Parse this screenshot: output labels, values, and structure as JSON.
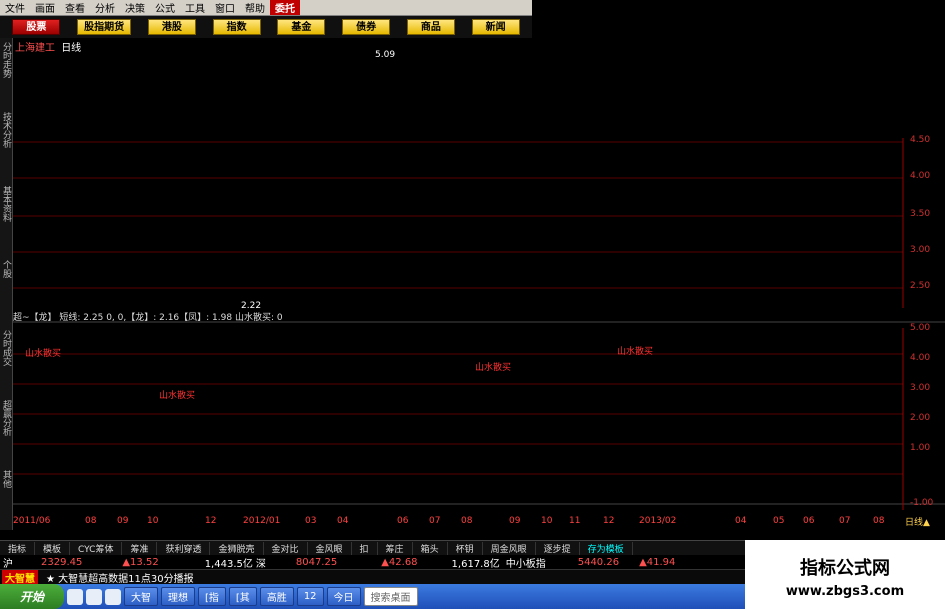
{
  "menu": [
    "文件",
    "画面",
    "查看",
    "分析",
    "决策",
    "公式",
    "工具",
    "窗口",
    "帮助",
    "委托"
  ],
  "categories": [
    "股票",
    "股指期货",
    "港股",
    "指数",
    "基金",
    "债券",
    "商品",
    "新闻"
  ],
  "left_tabs": [
    "分时走势",
    "技术分析",
    "基本资料",
    "个股",
    "分时成交",
    "超赢分析",
    "其他"
  ],
  "chart": {
    "stock_title": "上海建工",
    "period": "日线",
    "high_label": "5.09",
    "low_label": "2.22",
    "price_axis": [
      "4.50",
      "4.00",
      "3.50",
      "3.00",
      "2.50"
    ],
    "indicator_axis": [
      "5.00",
      "4.00",
      "3.00",
      "2.00",
      "1.00",
      "-1.00"
    ],
    "indicator_header": "超~【龙】 短线: 2.25  0, 0,【龙】: 2.16【凤】: 1.98  山水散买: 0",
    "annotations": [
      "山水散买",
      "山水散买",
      "山水散买",
      "山水散买"
    ],
    "date_axis": [
      "2011/06",
      "08",
      "09",
      "10",
      "12",
      "2012/01",
      "03",
      "04",
      "06",
      "07",
      "08",
      "09",
      "10",
      "11",
      "12",
      "2013/02",
      "04",
      "05",
      "06",
      "07",
      "08"
    ],
    "period_button": "日线▲"
  },
  "indicator_tabs": [
    "指标",
    "模板",
    "CYC筹体",
    "筹准",
    "获利穿透",
    "金狮脱壳",
    "金对比",
    "金风眼",
    "扣",
    "筹庄",
    "箱头",
    "杯钥",
    "周金风眼",
    "逐步提",
    "存为模板"
  ],
  "ticker": {
    "sh_label": "沪",
    "sh_index": "2329.45",
    "sh_change": "▲13.52",
    "sh_amount": "1,443.5亿",
    "sz_label": "深",
    "sz_index": "8047.25",
    "sz_change": "▲42.68",
    "sz_amount": "1,617.8亿",
    "sme_label": "中小板指",
    "sme_index": "5440.26",
    "sme_change": "▲41.94"
  },
  "news": {
    "brand": "大智慧",
    "text": "★ 大智慧超高数据11点30分播报"
  },
  "taskbar": {
    "start": "开始",
    "tasks": [
      "大智",
      "理想",
      "[指",
      "[其",
      "高胜",
      "12",
      "今日"
    ],
    "search": "搜索桌面"
  },
  "watermark": {
    "title": "指标公式网",
    "url": "www.zbgs3.com"
  }
}
